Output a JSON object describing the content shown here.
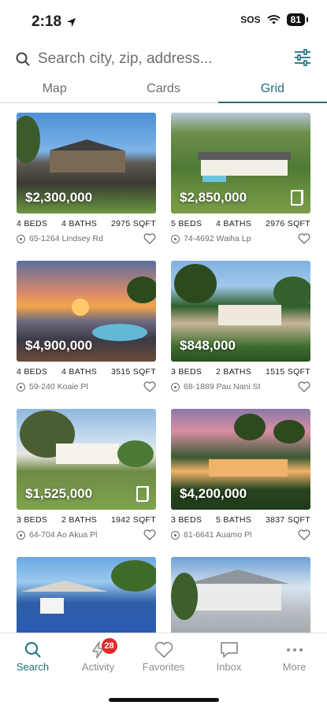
{
  "status": {
    "time": "2:18",
    "sos": "SOS",
    "battery": "81"
  },
  "search": {
    "placeholder": "Search city, zip, address..."
  },
  "tabs": [
    {
      "label": "Map",
      "active": false
    },
    {
      "label": "Cards",
      "active": false
    },
    {
      "label": "Grid",
      "active": true
    }
  ],
  "listings": [
    {
      "price": "$2,300,000",
      "beds": "4 BEDS",
      "baths": "4 BATHS",
      "sqft": "2975 SQFT",
      "address": "65-1264 Lindsey Rd",
      "tour": false
    },
    {
      "price": "$2,850,000",
      "beds": "5 BEDS",
      "baths": "4 BATHS",
      "sqft": "2976 SQFT",
      "address": "74-4692 Waiha Lp",
      "tour": true
    },
    {
      "price": "$4,900,000",
      "beds": "4 BEDS",
      "baths": "4 BATHS",
      "sqft": "3515 SQFT",
      "address": "59-240 Koaie Pl",
      "tour": false
    },
    {
      "price": "$848,000",
      "beds": "3 BEDS",
      "baths": "2 BATHS",
      "sqft": "1515 SQFT",
      "address": "68-1889 Pau Nani St",
      "tour": false
    },
    {
      "price": "$1,525,000",
      "beds": "3 BEDS",
      "baths": "2 BATHS",
      "sqft": "1942 SQFT",
      "address": "64-704 Ao Akua Pl",
      "tour": true
    },
    {
      "price": "$4,200,000",
      "beds": "3 BEDS",
      "baths": "5 BATHS",
      "sqft": "3837 SQFT",
      "address": "81-6641 Auamo Pl",
      "tour": false
    }
  ],
  "bottom_nav": [
    {
      "label": "Search",
      "active": true
    },
    {
      "label": "Activity",
      "active": false,
      "badge": "28"
    },
    {
      "label": "Favorites",
      "active": false
    },
    {
      "label": "Inbox",
      "active": false
    },
    {
      "label": "More",
      "active": false
    }
  ],
  "colors": {
    "accent": "#1f6f7a",
    "badge": "#e02b2b"
  }
}
